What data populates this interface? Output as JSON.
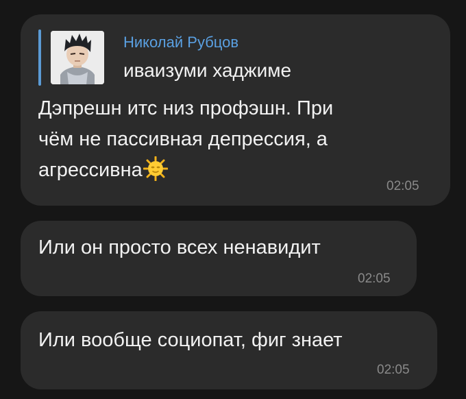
{
  "messages": [
    {
      "reply": {
        "author": "Николай Рубцов",
        "text": "иваизуми хаджиме",
        "avatar_icon": "anime-character-avatar"
      },
      "lines": [
        "Дэпрешн итс низ профэшн. При",
        "чём не пассивная депрессия, а",
        "агрессивна"
      ],
      "trailing_emoji": "sun-with-face-emoji",
      "time": "02:05"
    },
    {
      "lines": [
        "Или он просто всех ненавидит"
      ],
      "time": "02:05"
    },
    {
      "lines": [
        "Или вообще социопат, фиг знает"
      ],
      "time": "02:05"
    }
  ],
  "colors": {
    "background": "#161616",
    "bubble": "#2b2b2b",
    "reply_accent": "#5b9bd5",
    "author_name": "#5aa0e2",
    "text": "#f2f2f2",
    "timestamp": "#8a8a8a"
  }
}
